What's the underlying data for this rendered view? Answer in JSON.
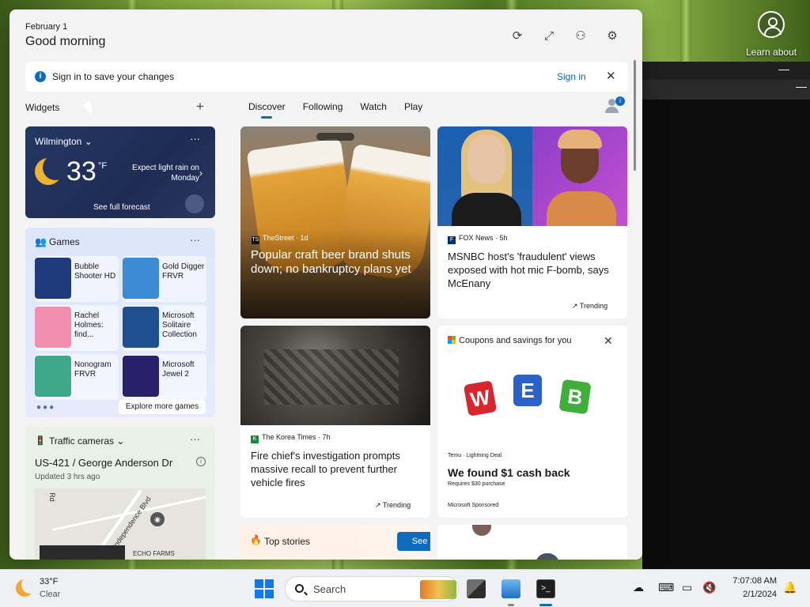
{
  "desktop": {
    "learn_label": "Learn about",
    "terminal_min": "—"
  },
  "header": {
    "date": "February 1",
    "greeting": "Good morning"
  },
  "signin": {
    "text": "Sign in to save your changes",
    "link": "Sign in"
  },
  "widgets": {
    "label": "Widgets",
    "weather": {
      "location": "Wilmington",
      "temp": "33",
      "unit": "°F",
      "forecast": "Expect light rain on Monday",
      "link": "See full forecast"
    },
    "games": {
      "title": "Games",
      "items": [
        {
          "name": "Bubble Shooter HD",
          "color": "#1e3a7a"
        },
        {
          "name": "Gold Digger FRVR",
          "color": "#3a8ad6"
        },
        {
          "name": "Rachel Holmes: find...",
          "color": "#f28fb0"
        },
        {
          "name": "Microsoft Solitaire Collection",
          "color": "#1f4f8f"
        },
        {
          "name": "Nonogram FRVR",
          "color": "#3fa88a"
        },
        {
          "name": "Microsoft Jewel 2",
          "color": "#2a1f6a"
        }
      ],
      "explore": "Explore more games"
    },
    "traffic": {
      "title": "Traffic cameras",
      "road": "US-421 / George Anderson Dr",
      "updated": "Updated 3 hrs ago",
      "map_labels": [
        "Rd",
        "Independence Blvd",
        "ECHO FARMS"
      ]
    }
  },
  "feed": {
    "tabs": [
      "Discover",
      "Following",
      "Watch",
      "Play"
    ],
    "cards": [
      {
        "source": "TheStreet · 1d",
        "title": "Popular craft beer brand shuts down; no bankruptcy plans yet"
      },
      {
        "source": "FOX News · 5h",
        "title": "MSNBC host's 'fraudulent' views exposed with hot mic F-bomb, says McEnany",
        "badge": "Trending"
      },
      {
        "source": "The Korea Times · 7h",
        "title": "Fire chief's investigation prompts massive recall to prevent further vehicle fires",
        "badge": "Trending"
      }
    ],
    "ad": {
      "header": "Coupons and savings for you",
      "cubes": [
        "W",
        "E",
        "B"
      ],
      "cube_colors": [
        "#d8262e",
        "#2a62c9",
        "#3fae3a"
      ],
      "sponsor_line": "Temu · Lightning Deal",
      "title": "We found $1 cash back",
      "requires": "Requires $30 purchase",
      "sponsored": "Microsoft Sponsored"
    },
    "top_stories": {
      "title": "Top stories",
      "button": "See more"
    }
  },
  "taskbar": {
    "temp": "33°F",
    "condition": "Clear",
    "search": "Search",
    "time": "7:07:08 AM",
    "date": "2/1/2024"
  }
}
